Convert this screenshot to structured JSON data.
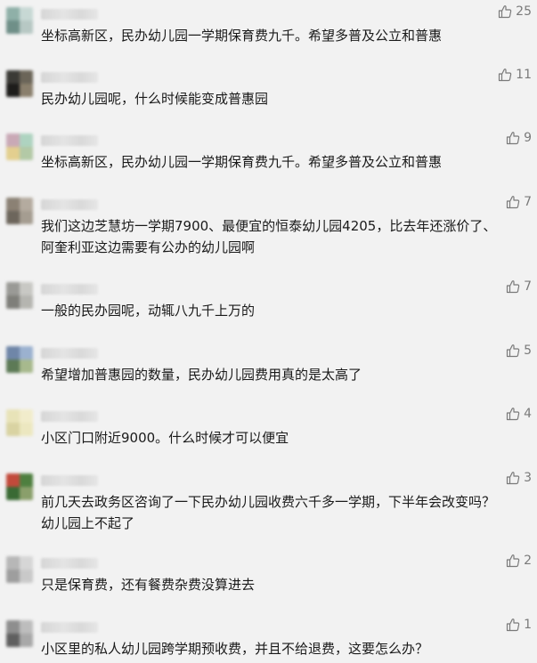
{
  "comments": [
    {
      "text": "坐标高新区，民办幼儿园一学期保育费九千。希望多普及公立和普惠",
      "likes": "25",
      "avatar": [
        "#8fb0a8",
        "#c7d8d4",
        "#6f8f88",
        "#b7c8c4"
      ]
    },
    {
      "text": "民办幼儿园呢，什么时候能变成普惠园",
      "likes": "11",
      "avatar": [
        "#3b3a36",
        "#6b6558",
        "#1e1d1b",
        "#8a7f6c"
      ]
    },
    {
      "text": "坐标高新区，民办幼儿园一学期保育费九千。希望多普及公立和普惠",
      "likes": "9",
      "avatar": [
        "#c9a9b6",
        "#aed3c0",
        "#e3cf8f",
        "#b3c9a6"
      ]
    },
    {
      "text": "我们这边芝慧坊一学期7900、最便宜的恒泰幼儿园4205，比去年还涨价了、阿奎利亚这边需要有公办的幼儿园啊",
      "likes": "7",
      "avatar": [
        "#8b8174",
        "#b4ab9f",
        "#6d665c",
        "#a59d91"
      ]
    },
    {
      "text": "一般的民办园呢，动辄八九千上万的",
      "likes": "7",
      "avatar": [
        "#9a9a96",
        "#c8c8c4",
        "#7f7f7a",
        "#b5b5b0"
      ]
    },
    {
      "text": "希望增加普惠园的数量，民办幼儿园费用真的是太高了",
      "likes": "5",
      "avatar": [
        "#6f86a8",
        "#9bb1cf",
        "#5d7a56",
        "#a7b98d"
      ]
    },
    {
      "text": "小区门口附近9000。什么时候才可以便宜",
      "likes": "4",
      "avatar": [
        "#e8e3b8",
        "#f1eccb",
        "#d9d3a2",
        "#ece7c0"
      ]
    },
    {
      "text": "前几天去政务区咨询了一下民办幼儿园收费六千多一学期，下半年会改变吗？幼儿园上不起了",
      "likes": "3",
      "avatar": [
        "#c24a3b",
        "#4e7f3f",
        "#3a6a34",
        "#8a9f6b"
      ]
    },
    {
      "text": "只是保育费，还有餐费杂费没算进去",
      "likes": "2",
      "avatar": [
        "#b7b7b7",
        "#d6d6d6",
        "#9e9e9e",
        "#c9c9c9"
      ]
    },
    {
      "text": "小区里的私人幼儿园跨学期预收费，并且不给退费，这要怎么办？",
      "likes": "1",
      "avatar": [
        "#8e8e8e",
        "#bdbdbd",
        "#5f5f5f",
        "#a8a8a8"
      ]
    }
  ],
  "icons": {
    "like": "thumbs-up-icon"
  }
}
